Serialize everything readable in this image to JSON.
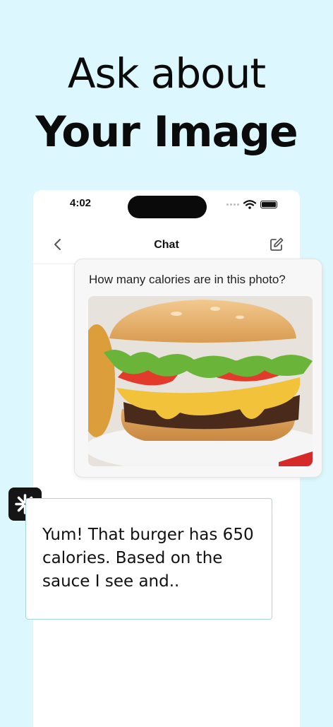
{
  "headline": {
    "line1": "Ask about",
    "line2": "Your Image"
  },
  "status_bar": {
    "time": "4:02"
  },
  "nav": {
    "title": "Chat"
  },
  "user_message": {
    "text": "How many calories are in this photo?",
    "image": "burger-photo"
  },
  "bot_message": {
    "text": "Yum! That burger has 650 calories. Based on the sauce I see and.."
  },
  "colors": {
    "background": "#dcf7fd",
    "bot_border": "#a9d6de"
  }
}
